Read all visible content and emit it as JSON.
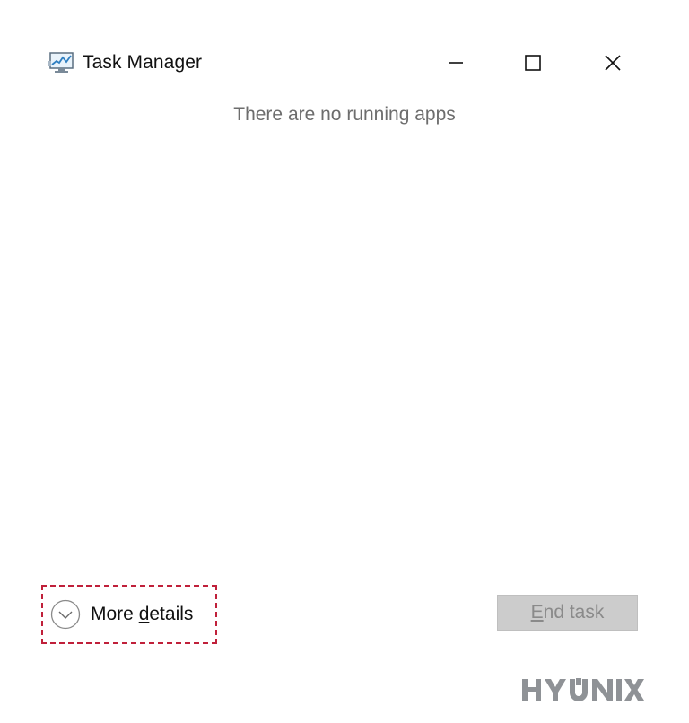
{
  "window": {
    "title": "Task Manager",
    "icon": "task-manager-monitor-icon",
    "controls": {
      "minimize_icon": "minimize-icon",
      "maximize_icon": "maximize-icon",
      "close_icon": "close-icon"
    }
  },
  "main": {
    "empty_message": "There are no running apps"
  },
  "footer": {
    "more_details": {
      "label_before": "More ",
      "label_underlined": "d",
      "label_after": "etails",
      "icon": "chevron-down-circle-icon",
      "highlight_color": "#c0203a"
    },
    "end_task": {
      "label_underlined": "E",
      "label_after": "nd task",
      "state": "disabled"
    }
  },
  "watermark": {
    "text": "HYUNIX"
  }
}
